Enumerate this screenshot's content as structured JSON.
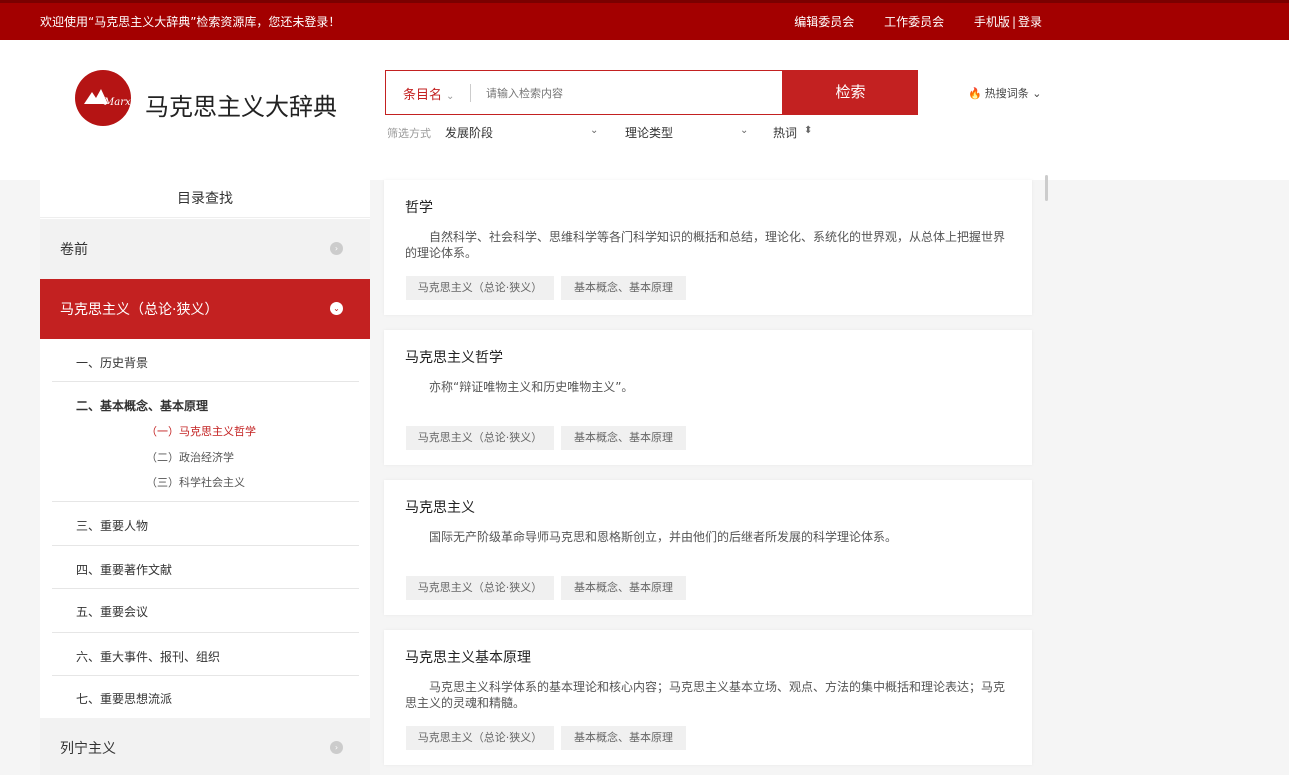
{
  "topbar": {
    "welcome": "欢迎使用“马克思主义大辞典”检索资源库，您还未登录！",
    "links": [
      "编辑委员会",
      "工作委员会",
      "手机版"
    ],
    "separator": "|",
    "login": "登录"
  },
  "header": {
    "logo_text": "Marx",
    "site_title": "马克思主义大辞典",
    "search": {
      "type_label": "条目名",
      "placeholder": "请输入检索内容",
      "button_label": "检索"
    },
    "hot_terms_label": "热搜词条"
  },
  "filters": {
    "label": "筛选方式",
    "items": [
      "发展阶段",
      "理论类型",
      "热词"
    ]
  },
  "sidebar": {
    "title": "目录查找",
    "sections": [
      {
        "label": "卷前"
      },
      {
        "label": "马克思主义（总论·狭义）"
      },
      {
        "label": "列宁主义"
      }
    ],
    "items": [
      "一、历史背景",
      "二、基本概念、基本原理",
      "三、重要人物",
      "四、重要著作文献",
      "五、重要会议",
      "六、重大事件、报刊、组织",
      "七、重要思想流派"
    ],
    "subitems": [
      "（一）马克思主义哲学",
      "（二）政治经济学",
      "（三）科学社会主义"
    ]
  },
  "results": [
    {
      "title": "哲学",
      "desc": "自然科学、社会科学、思维科学等各门科学知识的概括和总结，理论化、系统化的世界观，从总体上把握世界的理论体系。",
      "tags": [
        "马克思主义（总论·狭义）",
        "基本概念、基本原理"
      ]
    },
    {
      "title": "马克思主义哲学",
      "desc": "亦称“辩证唯物主义和历史唯物主义”。",
      "tags": [
        "马克思主义（总论·狭义）",
        "基本概念、基本原理"
      ]
    },
    {
      "title": "马克思主义",
      "desc": "国际无产阶级革命导师马克思和恩格斯创立，并由他们的后继者所发展的科学理论体系。",
      "tags": [
        "马克思主义（总论·狭义）",
        "基本概念、基本原理"
      ]
    },
    {
      "title": "马克思主义基本原理",
      "desc": "马克思主义科学体系的基本理论和核心内容；马克思主义基本立场、观点、方法的集中概括和理论表达；马克思主义的灵魂和精髓。",
      "tags": [
        "马克思主义（总论·狭义）",
        "基本概念、基本原理"
      ]
    }
  ],
  "colors": {
    "topbar": "#a30000",
    "accent": "#c32121"
  }
}
